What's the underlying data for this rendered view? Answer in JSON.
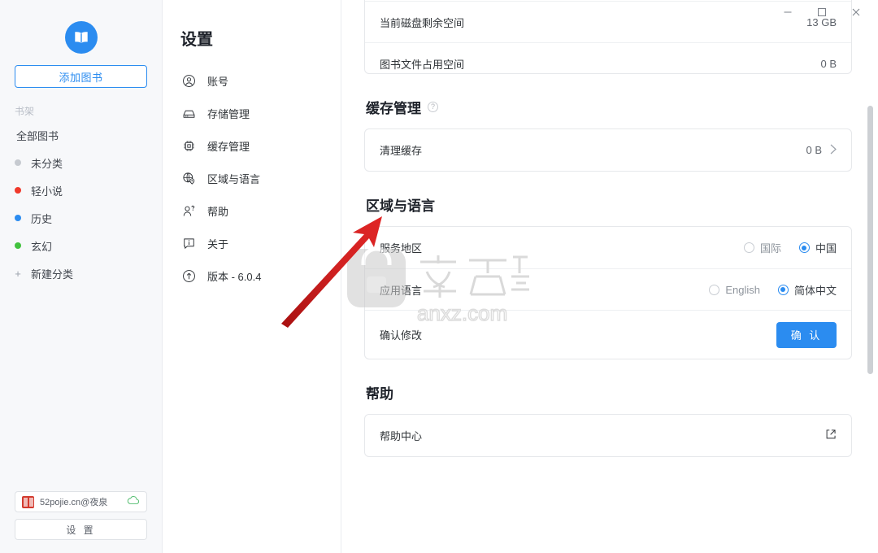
{
  "window": {
    "minimize_label": "—",
    "maximize_label": "□",
    "close_label": "×"
  },
  "library_sidebar": {
    "logo_icon": "open-book-icon",
    "add_book_label": "添加图书",
    "shelf_label": "书架",
    "all_books_label": "全部图书",
    "categories": [
      {
        "label": "未分类",
        "color": "#c6cad0"
      },
      {
        "label": "轻小说",
        "color": "#f0392b"
      },
      {
        "label": "历史",
        "color": "#2b8cf0"
      },
      {
        "label": "玄幻",
        "color": "#42c23e"
      }
    ],
    "new_category_label": "新建分类",
    "new_category_icon": "plus-icon",
    "account_name": "52pojie.cn@夜泉",
    "account_avatar_icon": "user-avatar-icon",
    "cloud_icon": "cloud-sync-icon",
    "settings_label": "设 置"
  },
  "settings_nav": {
    "title": "设置",
    "items": [
      {
        "label": "账号",
        "icon": "person-circle-icon"
      },
      {
        "label": "存储管理",
        "icon": "hard-drive-icon"
      },
      {
        "label": "缓存管理",
        "icon": "chip-icon"
      },
      {
        "label": "区域与语言",
        "icon": "globe-pin-icon"
      },
      {
        "label": "帮助",
        "icon": "person-question-icon"
      },
      {
        "label": "关于",
        "icon": "info-bubble-icon"
      },
      {
        "label": "版本 - 6.0.4",
        "icon": "arrow-up-circle-icon"
      }
    ]
  },
  "main": {
    "storage_card": {
      "rows": [
        {
          "label": "当前磁盘剩余空间",
          "value": "13 GB"
        },
        {
          "label": "图书文件占用空间",
          "value": "0 B"
        }
      ]
    },
    "cache_section": {
      "heading": "缓存管理",
      "help_icon": "question-mark-icon",
      "row_label": "清理缓存",
      "row_value": "0 B",
      "chevron_icon": "chevron-right-icon"
    },
    "region_section": {
      "heading": "区域与语言",
      "service_region": {
        "label": "服务地区",
        "options": [
          {
            "label": "国际",
            "selected": false
          },
          {
            "label": "中国",
            "selected": true
          }
        ]
      },
      "app_language": {
        "label": "应用语言",
        "options": [
          {
            "label": "English",
            "selected": false
          },
          {
            "label": "简体中文",
            "selected": true
          }
        ]
      },
      "confirm_row": {
        "label": "确认修改",
        "button_label": "确 认"
      }
    },
    "help_section": {
      "heading": "帮助",
      "row_label": "帮助中心",
      "external_icon": "external-link-icon"
    }
  },
  "watermark": {
    "brand_text": "安下载",
    "domain_text": "anxz.com"
  },
  "colors": {
    "accent": "#2b8cf0",
    "annotation_arrow": "#cc1f1f",
    "page_bg": "#ffffff",
    "sidebar_bg": "#f7f8fa"
  }
}
